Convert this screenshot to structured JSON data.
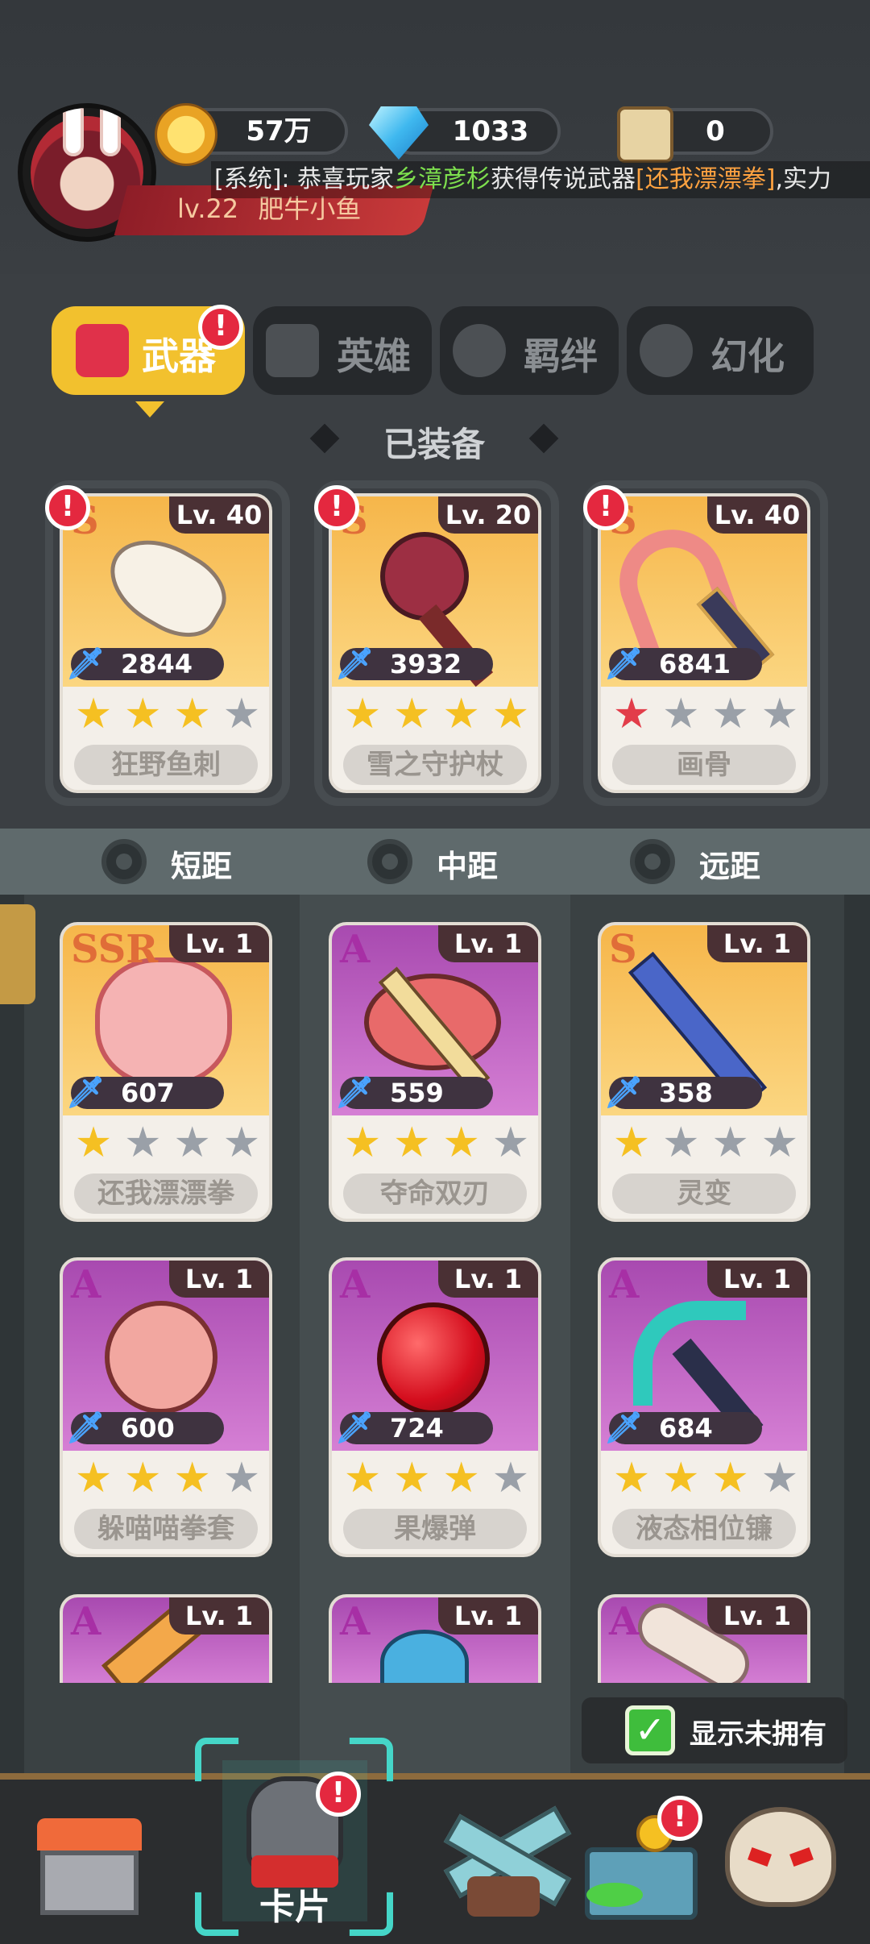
{
  "player": {
    "level": "lv.22",
    "name": "肥牛小鱼"
  },
  "resources": {
    "coins": "57万",
    "gems": "1033",
    "scrolls": "0"
  },
  "ticker": {
    "prefix": "[系统]: 恭喜玩家",
    "player": "乡漳彦杉",
    "mid": "获得传说武器",
    "item": "[还我漂漂拳]",
    "suffix": ",实力"
  },
  "tabs": [
    {
      "label": "武器",
      "active": true,
      "badge": "!"
    },
    {
      "label": "英雄",
      "active": false
    },
    {
      "label": "羁绊",
      "active": false
    },
    {
      "label": "幻化",
      "active": false
    }
  ],
  "equipped_title": "已装备",
  "equipped": [
    {
      "rarity": "S",
      "level": "Lv. 40",
      "power": "2844",
      "name": "狂野鱼刺",
      "stars": 3,
      "badge": "!"
    },
    {
      "rarity": "S",
      "level": "Lv. 20",
      "power": "3932",
      "name": "雪之守护杖",
      "stars": 4,
      "badge": "!"
    },
    {
      "rarity": "S",
      "level": "Lv. 40",
      "power": "6841",
      "name": "画骨",
      "stars": 1,
      "star_color": "red",
      "badge": "!"
    }
  ],
  "ranges": [
    "短距",
    "中距",
    "远距"
  ],
  "weapons": [
    {
      "rarity": "SSR",
      "level": "Lv. 1",
      "power": "607",
      "name": "还我漂漂拳",
      "stars": 1
    },
    {
      "rarity": "A",
      "level": "Lv. 1",
      "power": "559",
      "name": "夺命双刃",
      "stars": 3
    },
    {
      "rarity": "S",
      "level": "Lv. 1",
      "power": "358",
      "name": "灵变",
      "stars": 1
    },
    {
      "rarity": "A",
      "level": "Lv. 1",
      "power": "600",
      "name": "躲喵喵拳套",
      "stars": 3
    },
    {
      "rarity": "A",
      "level": "Lv. 1",
      "power": "724",
      "name": "果爆弹",
      "stars": 3
    },
    {
      "rarity": "A",
      "level": "Lv. 1",
      "power": "684",
      "name": "液态相位镰",
      "stars": 3
    },
    {
      "rarity": "A",
      "level": "Lv. 1"
    },
    {
      "rarity": "A",
      "level": "Lv. 1"
    },
    {
      "rarity": "A",
      "level": "Lv. 1"
    }
  ],
  "show_unowned": {
    "label": "显示未拥有",
    "checked": true
  },
  "bottom_nav": [
    {
      "name": "shop",
      "label": ""
    },
    {
      "name": "cards",
      "label": "卡片",
      "active": true,
      "badge": "!"
    },
    {
      "name": "battle",
      "label": ""
    },
    {
      "name": "treasure",
      "label": "",
      "badge": "!"
    },
    {
      "name": "boss",
      "label": ""
    }
  ],
  "colors": {
    "accent_yellow": "#f2c12e",
    "badge_red": "#e4283f",
    "green_check": "#3fbd3c"
  }
}
